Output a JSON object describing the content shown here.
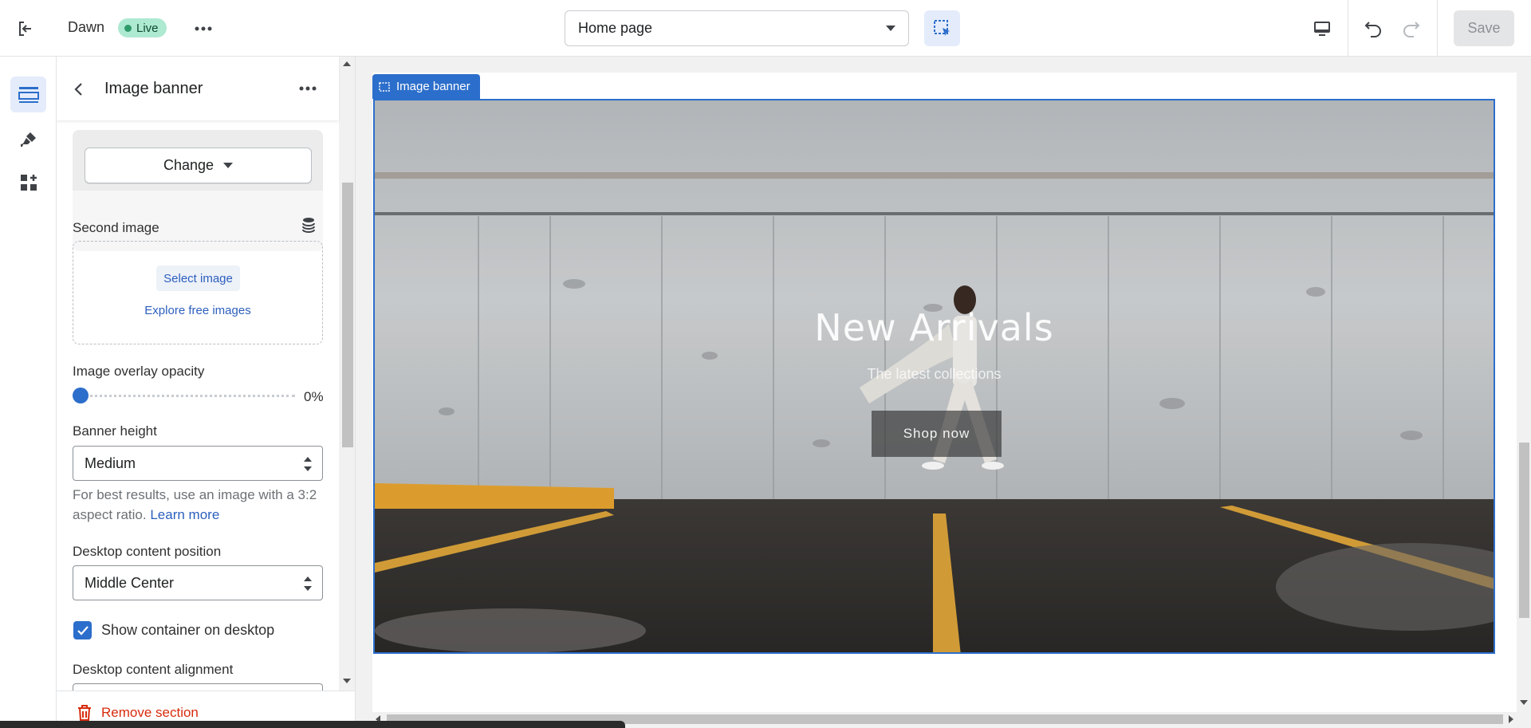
{
  "topbar": {
    "theme_name": "Dawn",
    "status_badge": "Live",
    "page_selector": "Home page",
    "save_label": "Save"
  },
  "panel": {
    "title": "Image banner",
    "change_button": "Change",
    "second_image_label": "Second image",
    "select_image_button": "Select image",
    "explore_link": "Explore free images",
    "overlay_label": "Image overlay opacity",
    "overlay_value": "0%",
    "overlay_fraction": 0,
    "banner_height_label": "Banner height",
    "banner_height_value": "Medium",
    "help_text": "For best results, use an image with a 3:2 aspect ratio.",
    "help_link": "Learn more",
    "content_position_label": "Desktop content position",
    "content_position_value": "Middle Center",
    "show_container_label": "Show container on desktop",
    "show_container_checked": true,
    "content_alignment_label": "Desktop content alignment",
    "remove_section": "Remove section"
  },
  "preview": {
    "section_label": "Image banner",
    "banner_title": "New Arrivals",
    "banner_subtitle": "The latest collections",
    "banner_button": "Shop now"
  },
  "colors": {
    "accent": "#2c6ecb",
    "live_badge": "#aee9d1",
    "danger": "#d72c0d"
  }
}
